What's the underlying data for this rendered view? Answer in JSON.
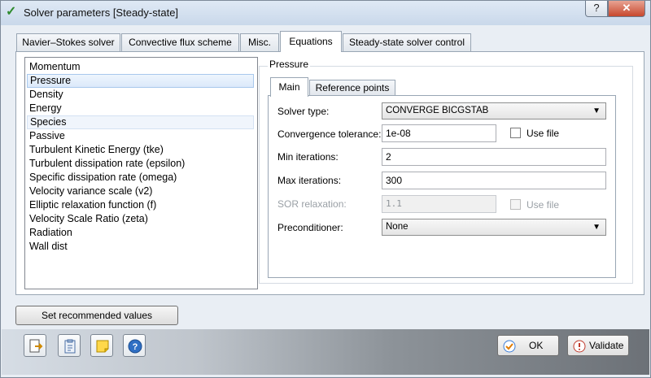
{
  "window": {
    "title": "Solver parameters [Steady-state]",
    "help_label": "?",
    "close_label": "✕"
  },
  "tabs": [
    {
      "label": "Navier–Stokes solver"
    },
    {
      "label": "Convective flux scheme"
    },
    {
      "label": "Misc."
    },
    {
      "label": "Equations"
    },
    {
      "label": "Steady-state solver control"
    }
  ],
  "active_tab": "Equations",
  "equations": [
    "Momentum",
    "Pressure",
    "Density",
    "Energy",
    "Species",
    "Passive",
    "Turbulent Kinetic Energy (tke)",
    "Turbulent dissipation rate (epsilon)",
    "Specific dissipation rate (omega)",
    "Velocity variance scale (v2)",
    "Elliptic relaxation function (f)",
    "Velocity Scale Ratio (zeta)",
    "Radiation",
    "Wall dist"
  ],
  "selected_equation": "Pressure",
  "group": {
    "title": "Pressure",
    "tabs": [
      {
        "label": "Main"
      },
      {
        "label": "Reference points"
      }
    ],
    "fields": {
      "solver_type": {
        "label": "Solver type:",
        "value": "CONVERGE BICGSTAB"
      },
      "convergence_tolerance": {
        "label": "Convergence tolerance:",
        "value": "1e-08",
        "use_file_label": "Use file"
      },
      "min_iterations": {
        "label": "Min iterations:",
        "value": "2"
      },
      "max_iterations": {
        "label": "Max iterations:",
        "value": "300"
      },
      "sor_relaxation": {
        "label": "SOR relaxation:",
        "value": "1.1",
        "use_file_label": "Use file"
      },
      "preconditioner": {
        "label": "Preconditioner:",
        "value": "None"
      }
    }
  },
  "buttons": {
    "set_recommended": "Set recommended values",
    "ok": "OK",
    "validate": "Validate"
  },
  "icons": {
    "export": "export-icon",
    "clipboard": "clipboard-icon",
    "note": "note-icon",
    "help": "help-icon"
  },
  "colors": {
    "selection": "#dbe9fa",
    "title_check": "#2e8b2e",
    "close_button": "#c7482e"
  }
}
